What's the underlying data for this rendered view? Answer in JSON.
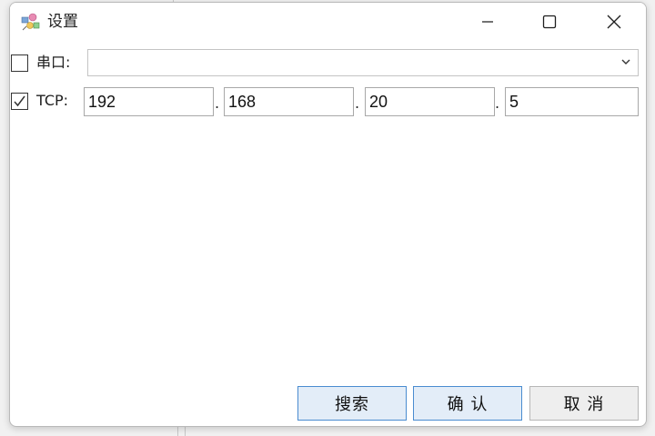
{
  "window": {
    "title": "设置"
  },
  "serial": {
    "label": "串口:",
    "checked": false,
    "value": ""
  },
  "tcp": {
    "label": "TCP:",
    "checked": true,
    "ip": [
      "192",
      "168",
      "20",
      "5"
    ],
    "separator": "."
  },
  "buttons": {
    "search": "搜索",
    "confirm": "确 认",
    "cancel": "取 消"
  },
  "colors": {
    "primary_button_border": "#4a8cd0",
    "primary_button_bg": "#e3edf8"
  }
}
